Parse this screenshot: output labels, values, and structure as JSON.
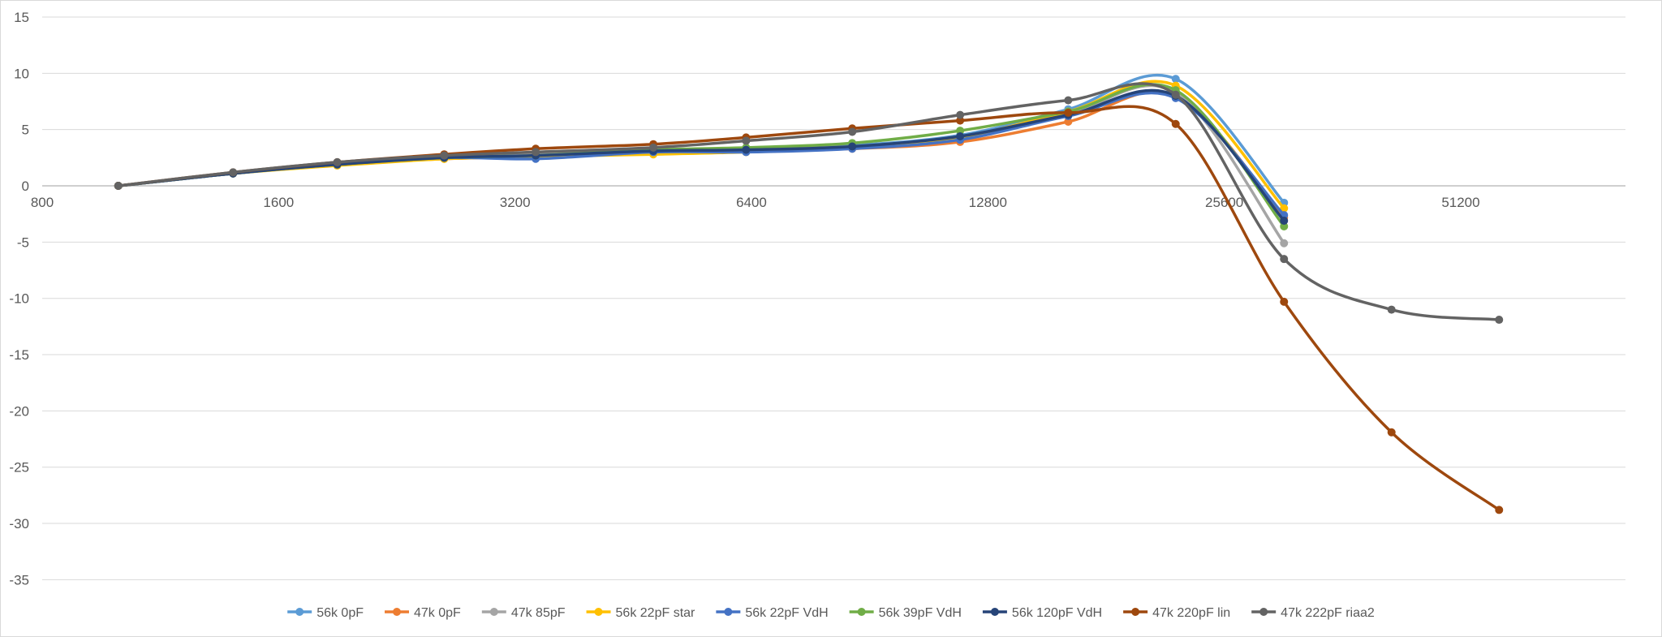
{
  "chart_data": {
    "type": "line",
    "title": "",
    "xlabel": "",
    "ylabel": "",
    "x_scale": "log2",
    "xlim": [
      800,
      83000
    ],
    "ylim": [
      -38,
      15
    ],
    "x_ticks": [
      800,
      1600,
      3200,
      6400,
      12800,
      25600,
      51200
    ],
    "x_tick_labels": [
      "800",
      "1600",
      "3200",
      "6400",
      "12800",
      "25600",
      "51200"
    ],
    "y_ticks": [
      15,
      10,
      5,
      0,
      -5,
      -10,
      -15,
      -20,
      -25,
      -30,
      -35
    ],
    "y_tick_labels": [
      "15",
      "10",
      "5",
      "0",
      "-5",
      "-10",
      "-15",
      "-20",
      "-25",
      "-30",
      "-35"
    ],
    "grid": true,
    "legend_position": "bottom",
    "x": [
      1000,
      1400,
      1900,
      2600,
      3400,
      4800,
      6300,
      8600,
      11800,
      16200,
      22200,
      30500,
      41800,
      57300
    ],
    "series": [
      {
        "name": "56k 0pF",
        "color": "#5B9BD5",
        "values": [
          0,
          1.1,
          1.9,
          2.5,
          2.7,
          3.2,
          3.3,
          3.6,
          4.5,
          6.8,
          9.5,
          -1.5,
          null,
          null
        ]
      },
      {
        "name": "47k 0pF",
        "color": "#ED7D31",
        "values": [
          0,
          1.1,
          1.9,
          2.4,
          2.6,
          2.9,
          3.1,
          3.3,
          3.9,
          5.7,
          8.0,
          -2.8,
          null,
          null
        ]
      },
      {
        "name": "47k 85pF",
        "color": "#A5A5A5",
        "values": [
          0,
          1.1,
          1.9,
          2.5,
          2.8,
          3.1,
          3.3,
          3.5,
          4.3,
          6.4,
          8.3,
          -5.1,
          null,
          null
        ]
      },
      {
        "name": "56k 22pF star",
        "color": "#FFC000",
        "values": [
          0,
          1.1,
          1.8,
          2.4,
          2.6,
          2.8,
          3.0,
          3.4,
          4.3,
          6.6,
          8.9,
          -2.0,
          null,
          null
        ]
      },
      {
        "name": "56k 22pF VdH",
        "color": "#4472C4",
        "values": [
          0,
          1.1,
          1.9,
          2.5,
          2.4,
          3.0,
          3.0,
          3.3,
          4.1,
          6.2,
          7.8,
          -2.6,
          null,
          null
        ]
      },
      {
        "name": "56k 39pF VdH",
        "color": "#70AD47",
        "values": [
          0,
          1.1,
          1.9,
          2.5,
          2.7,
          3.2,
          3.4,
          3.8,
          4.9,
          6.6,
          8.5,
          -3.6,
          null,
          null
        ]
      },
      {
        "name": "56k 120pF VdH",
        "color": "#264478",
        "values": [
          0,
          1.1,
          1.9,
          2.5,
          2.7,
          3.1,
          3.2,
          3.5,
          4.4,
          6.3,
          8.0,
          -3.1,
          null,
          null
        ]
      },
      {
        "name": "47k 220pF lin",
        "color": "#9E480E",
        "values": [
          0,
          1.2,
          2.1,
          2.8,
          3.3,
          3.7,
          4.3,
          5.1,
          5.8,
          6.5,
          5.5,
          -10.3,
          -21.9,
          -28.8
        ]
      },
      {
        "name": "47k 222pF riaa2",
        "color": "#636363",
        "values": [
          0,
          1.2,
          2.1,
          2.7,
          3.0,
          3.4,
          4.0,
          4.8,
          6.3,
          7.6,
          8.1,
          -6.5,
          -11.0,
          -11.9
        ]
      }
    ]
  }
}
